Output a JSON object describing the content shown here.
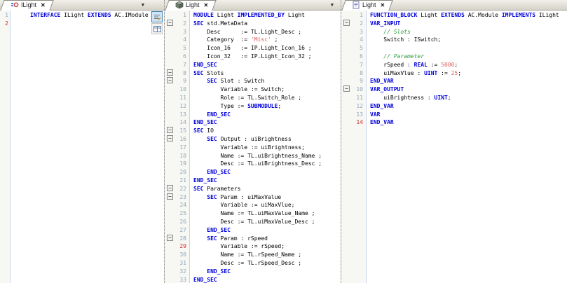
{
  "syntax": {
    "keywords": [
      "IMPLEMENTED_BY",
      "FUNCTION_BLOCK",
      "VAR_OUTPUT",
      "VAR_INPUT",
      "INTERFACE",
      "SUBMODULE",
      "IMPLEMENTS",
      "END_VAR",
      "END_SEC",
      "EXTENDS",
      "MODULE",
      "REAL",
      "UINT",
      "VAR",
      "SEC"
    ],
    "colors": {
      "keyword": "#0000dd",
      "literal": "#e06060",
      "comment": "#2e9e3e",
      "line_number": "#93a8bb",
      "modified_line_number": "#cc2a2a"
    }
  },
  "icons": {
    "close": "✕",
    "dropdown": "▼",
    "fold_marker": "−"
  },
  "panels": [
    {
      "tab": {
        "label": "ILight",
        "icon": "interface-icon"
      },
      "has_dropdown": true,
      "has_fold_column": false,
      "has_mini_toolbar": true,
      "red_lines": [
        2
      ],
      "fold_lines": [],
      "lines": [
        "INTERFACE ILight EXTENDS AC.IModule",
        ""
      ]
    },
    {
      "tab": {
        "label": "Light",
        "icon": "module-icon"
      },
      "has_dropdown": true,
      "has_fold_column": true,
      "has_mini_toolbar": false,
      "red_lines": [
        29
      ],
      "fold_lines": [
        2,
        8,
        9,
        15,
        16,
        22,
        23,
        28
      ],
      "lines": [
        "MODULE Light IMPLEMENTED_BY Light",
        "SEC std.MetaData",
        "    Desc      := TL.Light_Desc ;",
        "    Category  := 'Misc' ;",
        "    Icon_16   := IP.Light_Icon_16 ;",
        "    Icon_32   := IP.Light_Icon_32 ;",
        "END_SEC",
        "SEC Slots",
        "    SEC Slot : Switch",
        "        Variable := Switch;",
        "        Role := TL.Switch_Role ;",
        "        Type := SUBMODULE;",
        "    END_SEC",
        "END_SEC",
        "SEC IO",
        "    SEC Output : uiBrightness",
        "        Variable := uiBrightness;",
        "        Name := TL.uiBrightness_Name ;",
        "        Desc := TL.uiBrightness_Desc ;",
        "    END_SEC",
        "END_SEC",
        "SEC Parameters",
        "    SEC Param : uiMaxValue",
        "        Variable := uiMaxVlue;",
        "        Name := TL.uiMaxValue_Name ;",
        "        Desc := TL.uiMaxValue_Desc ;",
        "    END_SEC",
        "    SEC Param : rSpeed",
        "        Variable := rSpeed;",
        "        Name := TL.rSpeed_Name ;",
        "        Desc := TL.rSpeed_Desc ;",
        "    END_SEC",
        "END_SEC"
      ]
    },
    {
      "tab": {
        "label": "Light",
        "icon": "pou-icon"
      },
      "has_dropdown": false,
      "has_fold_column": true,
      "has_mini_toolbar": false,
      "red_lines": [
        14
      ],
      "fold_lines": [
        2,
        10
      ],
      "lines": [
        "FUNCTION_BLOCK Light EXTENDS AC.Module IMPLEMENTS ILight",
        "VAR_INPUT",
        "    // Slots",
        "    Switch : ISwitch;",
        "",
        "    // Parameter",
        "    rSpeed : REAL := 5000;",
        "    uiMaxVlue : UINT := 25;",
        "END_VAR",
        "VAR_OUTPUT",
        "    uiBrightness : UINT;",
        "END_VAR",
        "VAR",
        "END_VAR"
      ]
    }
  ]
}
